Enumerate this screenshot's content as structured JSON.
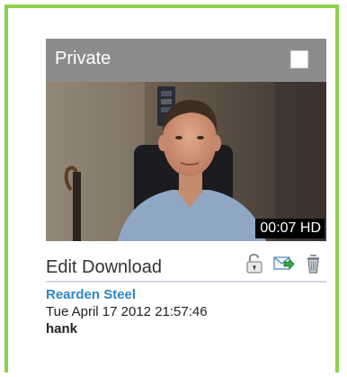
{
  "card": {
    "privacy_label": "Private",
    "duration": "00:07 HD"
  },
  "actions": {
    "edit_label": "Edit",
    "download_label": "Download",
    "icons": [
      "unlock-icon",
      "send-email-icon",
      "trash-icon"
    ]
  },
  "meta": {
    "owner": "Rearden Steel",
    "datetime": "Tue April 17 2012 21:57:46",
    "user": "hank"
  },
  "colors": {
    "frame_border": "#8dd24a",
    "header_bg": "#8c8c8c",
    "owner_link": "#2f86c7"
  }
}
